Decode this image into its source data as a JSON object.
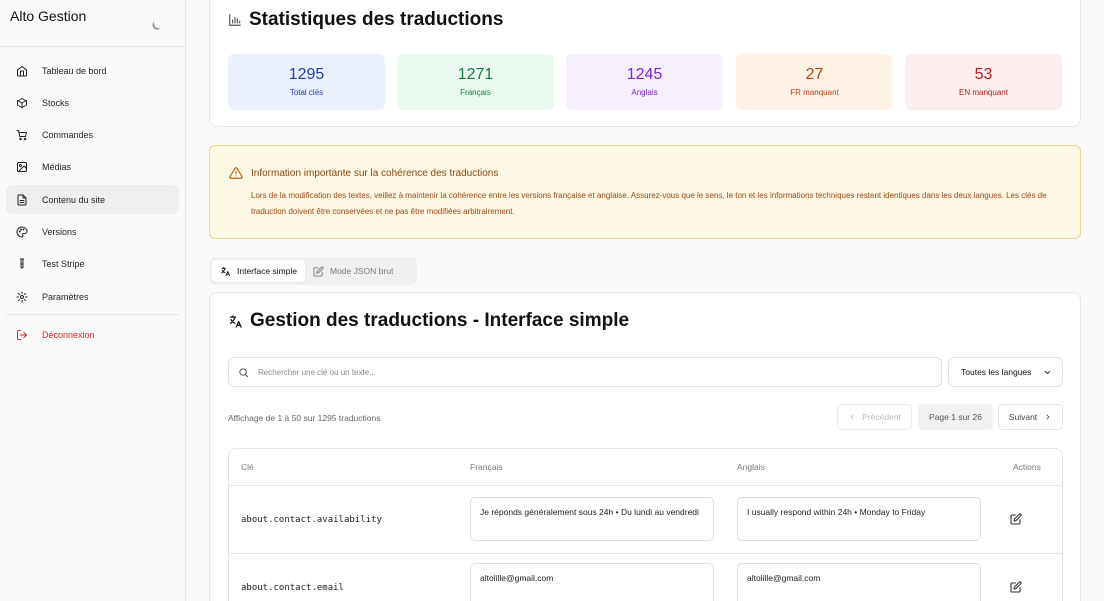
{
  "app": {
    "brand": "Alto Gestion"
  },
  "sidebar": {
    "items": [
      {
        "label": "Tableau de bord"
      },
      {
        "label": "Stocks"
      },
      {
        "label": "Commandes"
      },
      {
        "label": "Médias"
      },
      {
        "label": "Contenu du site"
      },
      {
        "label": "Versions"
      },
      {
        "label": "Test Stripe"
      },
      {
        "label": "Paramètres"
      }
    ],
    "logout": "Déconnexion"
  },
  "stats": {
    "title": "Statistiques des traductions",
    "cards": [
      {
        "value": "1295",
        "label": "Total clés",
        "bg": "#eaf1fd",
        "color": "#1e3fae"
      },
      {
        "value": "1271",
        "label": "Français",
        "bg": "#eafaf0",
        "color": "#15803d"
      },
      {
        "value": "1245",
        "label": "Anglais",
        "bg": "#f6effd",
        "color": "#7e22ce"
      },
      {
        "value": "27",
        "label": "FR manquant",
        "bg": "#fff3e8",
        "color": "#c2410c"
      },
      {
        "value": "53",
        "label": "EN manquant",
        "bg": "#fdeeee",
        "color": "#b91c1c"
      }
    ]
  },
  "alert": {
    "title": "Information importante sur la cohérence des traductions",
    "body": "Lors de la modification des textes, veillez à maintenir la cohérence entre les versions française et anglaise. Assurez-vous que le sens, le ton et les informations techniques restent identiques dans les deux langues. Les clés de traduction doivent être conservées et ne pas être modifiées arbitrairement."
  },
  "tabs": [
    {
      "label": "Interface simple",
      "active": true
    },
    {
      "label": "Mode JSON brut",
      "active": false
    }
  ],
  "translations": {
    "title": "Gestion des traductions - Interface simple",
    "search_placeholder": "Rechercher une clé ou un texte...",
    "language_filter": "Toutes les langues",
    "showing": "Affichage de 1 à 50 sur 1295 traductions",
    "pager": {
      "prev": "Précédent",
      "page": "Page 1 sur 26",
      "next": "Suivant"
    },
    "columns": {
      "key": "Clé",
      "fr": "Français",
      "en": "Anglais",
      "actions": "Actions"
    },
    "rows": [
      {
        "key": "about.contact.availability",
        "fr": "Je réponds généralement sous 24h  •  Du lundi au vendredi",
        "en": "I usually respond within 24h  •  Monday to Friday"
      },
      {
        "key": "about.contact.email",
        "fr": "altolille@gmail.com",
        "en": "altolille@gmail.com"
      }
    ]
  }
}
